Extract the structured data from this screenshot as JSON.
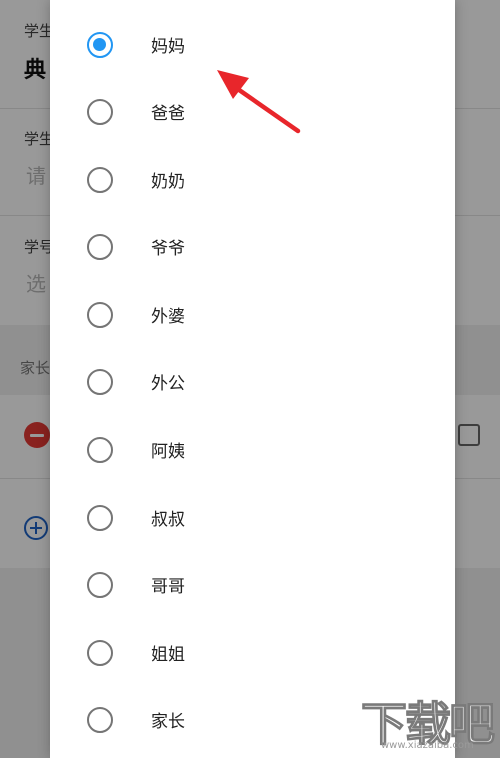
{
  "background_form": {
    "student_name_label": "学生",
    "student_name_value": "典",
    "student_gender_label": "学生",
    "student_gender_placeholder": "请",
    "student_id_label": "学号",
    "student_id_placeholder": "选",
    "parent_section_title": "家长",
    "minus_icon": "minus-circle-icon",
    "phone_icon": "phone-icon",
    "plus_icon": "plus-circle-icon"
  },
  "dialog": {
    "options": [
      {
        "label": "妈妈",
        "selected": true
      },
      {
        "label": "爸爸",
        "selected": false
      },
      {
        "label": "奶奶",
        "selected": false
      },
      {
        "label": "爷爷",
        "selected": false
      },
      {
        "label": "外婆",
        "selected": false
      },
      {
        "label": "外公",
        "selected": false
      },
      {
        "label": "阿姨",
        "selected": false
      },
      {
        "label": "叔叔",
        "selected": false
      },
      {
        "label": "哥哥",
        "selected": false
      },
      {
        "label": "姐姐",
        "selected": false
      },
      {
        "label": "家长",
        "selected": false
      }
    ],
    "selected_color": "#2196f3",
    "unselected_color": "#757575"
  },
  "annotation": {
    "arrow_color": "#e8262b"
  },
  "watermark": {
    "main": "下载吧",
    "url": "www.xiazaiba.com"
  }
}
